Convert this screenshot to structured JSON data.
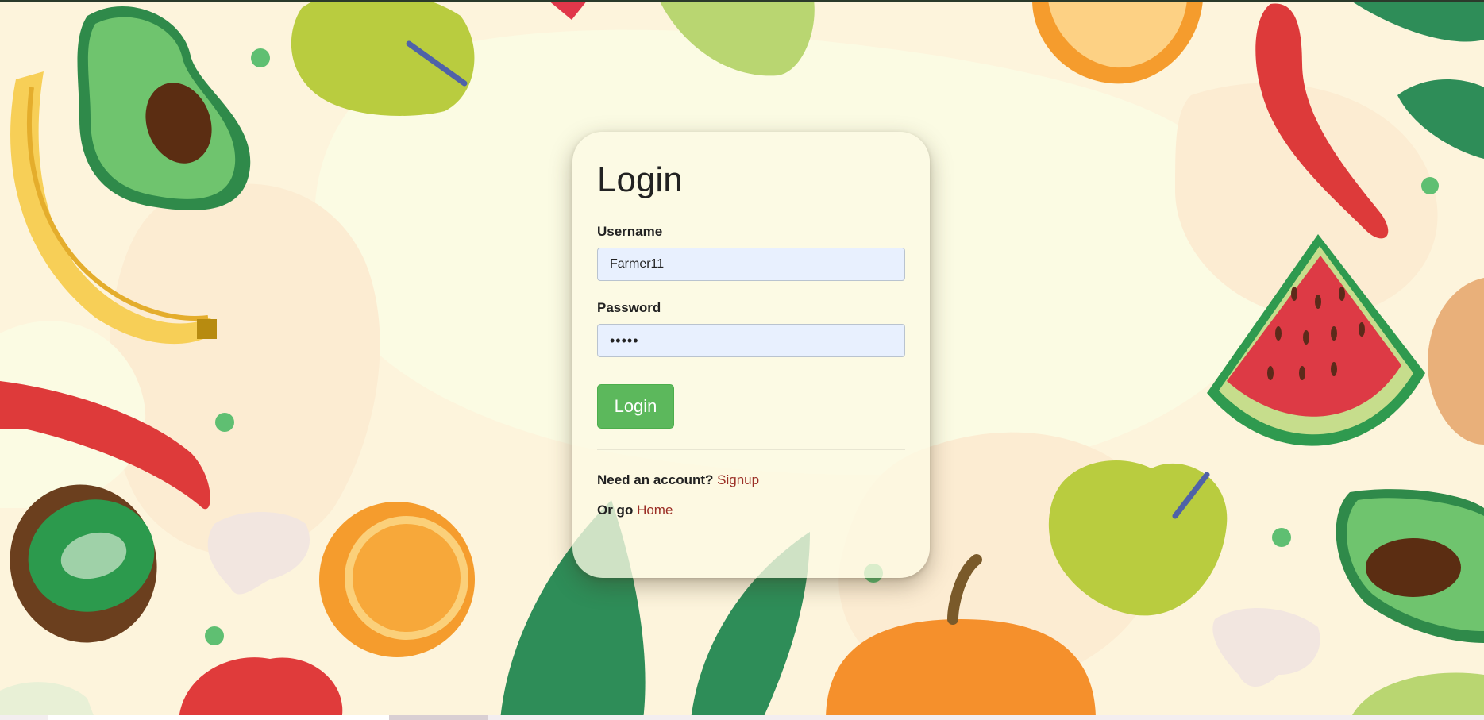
{
  "login": {
    "title": "Login",
    "username_label": "Username",
    "username_value": "Farmer11",
    "password_label": "Password",
    "password_value": "•••••",
    "submit_label": "Login",
    "signup_prompt": "Need an account?",
    "signup_link": "Signup",
    "home_prompt": "Or go",
    "home_link": "Home"
  },
  "colors": {
    "background": "#fdf4dc",
    "button": "#5cb85c",
    "link": "#9b2e25",
    "input_fill": "#e8f0fe"
  }
}
